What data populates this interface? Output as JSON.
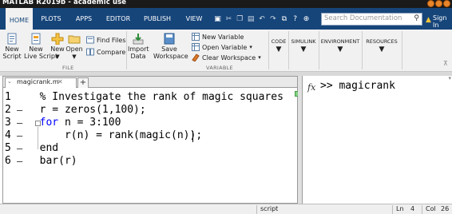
{
  "app": {
    "title": "MATLAB R2019b - academic use"
  },
  "tabs": [
    {
      "label": "HOME"
    },
    {
      "label": "PLOTS"
    },
    {
      "label": "APPS"
    },
    {
      "label": "EDITOR"
    },
    {
      "label": "PUBLISH"
    },
    {
      "label": "VIEW"
    }
  ],
  "active_tab": "HOME",
  "search": {
    "placeholder": "Search Documentation"
  },
  "signin": "Sign In",
  "ribbon": {
    "new_script": "New\nScript",
    "new_live_script": "New\nLive Script",
    "new": "New",
    "open": "Open",
    "find_files": "Find Files",
    "compare": "Compare",
    "file_group": "FILE",
    "import_data": "Import\nData",
    "save_workspace": "Save\nWorkspace",
    "new_variable": "New Variable",
    "open_variable": "Open Variable",
    "clear_workspace": "Clear Workspace",
    "variable_group": "VARIABLE",
    "code": "CODE",
    "simulink": "SIMULINK",
    "environment": "ENVIRONMENT",
    "resources": "RESOURCES"
  },
  "editor": {
    "file_tab": "magicrank.m",
    "lines": [
      {
        "num": "1",
        "dash": "",
        "code": "  % Investigate the rank of magic squares"
      },
      {
        "num": "2",
        "dash": "–",
        "code": "  r = zeros(1,100);"
      },
      {
        "num": "3",
        "dash": "–",
        "code": "  for n = 3:100"
      },
      {
        "num": "4",
        "dash": "–",
        "code": "      r(n) = rank(magic(n));"
      },
      {
        "num": "5",
        "dash": "–",
        "code": "  end"
      },
      {
        "num": "6",
        "dash": "–",
        "code": "  bar(r)"
      }
    ]
  },
  "command_window": {
    "fx": "fx",
    "prompt": ">>",
    "command": "magicrank"
  },
  "status": {
    "mode": "script",
    "ln_label": "Ln",
    "ln_value": "4",
    "col_label": "Col",
    "col_value": "26"
  },
  "colors": {
    "tabstrip": "#16457a",
    "comment": "#228b22",
    "keyword": "#0000ff"
  }
}
